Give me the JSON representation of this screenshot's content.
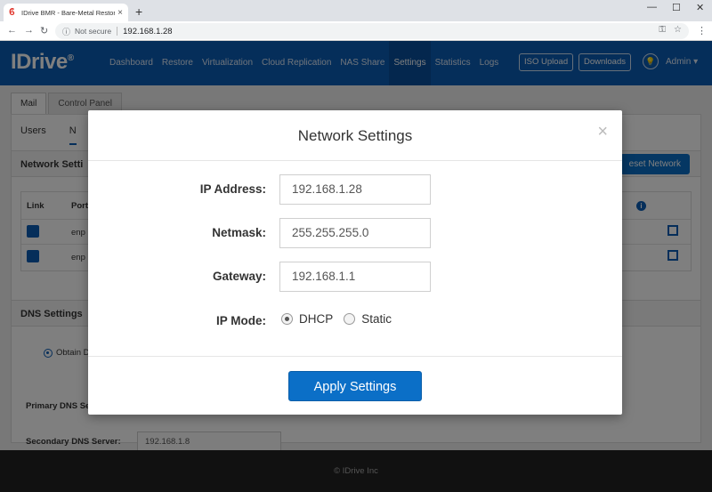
{
  "browser": {
    "tab_title": "IDrive BMR - Bare-Metal Restore",
    "tab_close": "×",
    "new_tab": "+",
    "win_minimize": "—",
    "win_maximize": "☐",
    "win_close": "✕",
    "not_secure": "Not secure",
    "url": "192.168.1.28"
  },
  "app": {
    "logo": "IDrive",
    "logo_mark": "®",
    "nav": [
      "Dashboard",
      "Restore",
      "Virtualization",
      "Cloud Replication",
      "NAS Share",
      "Settings",
      "Statistics",
      "Logs"
    ],
    "active_nav": "Settings",
    "iso_upload": "ISO Upload",
    "downloads": "Downloads",
    "admin": "Admin ▾"
  },
  "background": {
    "subtabs": [
      "Mail",
      "Control Panel"
    ],
    "inner_tabs": [
      "Users",
      "N"
    ],
    "network_section": "Network Setti",
    "reset_network": "eset Network",
    "table_headers": [
      "Link",
      "Port"
    ],
    "rows": [
      "enp",
      "enp"
    ],
    "dns_section": "DNS Settings",
    "obtain_dns": "Obtain D",
    "primary_dns_label": "Primary DNS Se",
    "secondary_dns_label": "Secondary DNS Server:",
    "secondary_dns_value": "192.168.1.8"
  },
  "footer": {
    "copyright": "© IDrive Inc"
  },
  "modal": {
    "title": "Network Settings",
    "close": "×",
    "fields": [
      {
        "label": "IP Address:",
        "value": "192.168.1.28"
      },
      {
        "label": "Netmask:",
        "value": "255.255.255.0"
      },
      {
        "label": "Gateway:",
        "value": "192.168.1.1"
      }
    ],
    "ip_mode_label": "IP Mode:",
    "ip_mode_options": [
      "DHCP",
      "Static"
    ],
    "ip_mode_selected": "DHCP",
    "apply_label": "Apply Settings"
  },
  "colors": {
    "brand": "#0b5db5",
    "button": "#0b6fc7"
  }
}
